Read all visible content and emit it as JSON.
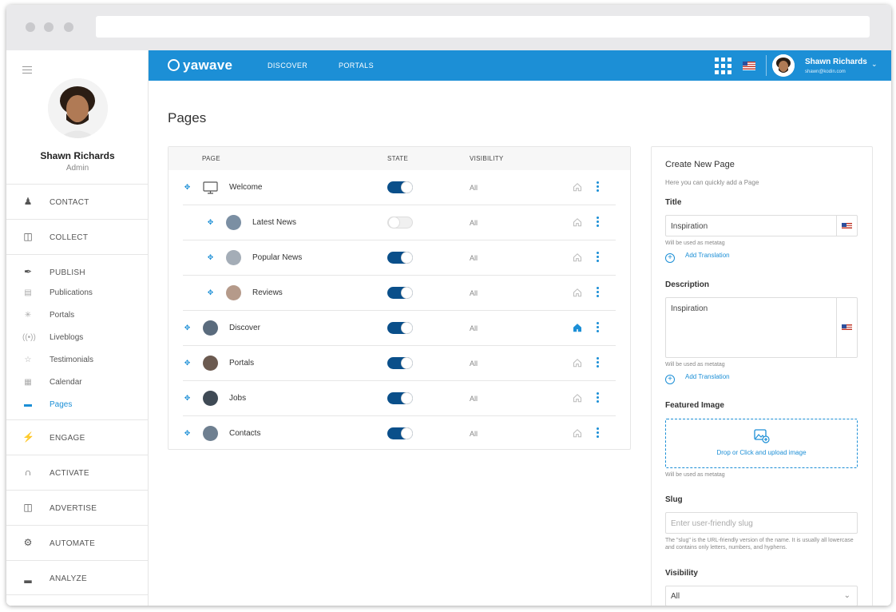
{
  "sidebar": {
    "user_name": "Shawn Richards",
    "user_role": "Admin",
    "sections": [
      {
        "label": "CONTACT",
        "icon": "contact-icon"
      },
      {
        "label": "COLLECT",
        "icon": "collect-icon"
      },
      {
        "label": "PUBLISH",
        "icon": "publish-icon"
      },
      {
        "label": "ENGAGE",
        "icon": "engage-icon"
      },
      {
        "label": "ACTIVATE",
        "icon": "activate-icon"
      },
      {
        "label": "ADVERTISE",
        "icon": "advertise-icon"
      },
      {
        "label": "AUTOMATE",
        "icon": "automate-icon"
      },
      {
        "label": "ANALYZE",
        "icon": "analyze-icon"
      }
    ],
    "publish_items": [
      {
        "label": "Publications",
        "icon": "publications-icon"
      },
      {
        "label": "Portals",
        "icon": "portals-icon"
      },
      {
        "label": "Liveblogs",
        "icon": "liveblogs-icon"
      },
      {
        "label": "Testimonials",
        "icon": "testimonials-icon"
      },
      {
        "label": "Calendar",
        "icon": "calendar-icon"
      },
      {
        "label": "Pages",
        "icon": "pages-icon"
      }
    ]
  },
  "topbar": {
    "logo_text": "yawave",
    "nav": [
      "DISCOVER",
      "PORTALS"
    ],
    "user_name": "Shawn Richards",
    "user_email": "shawn@kodin.com"
  },
  "main": {
    "title": "Pages",
    "columns": {
      "page": "PAGE",
      "state": "STATE",
      "visibility": "VISIBILITY"
    },
    "rows": [
      {
        "name": "Welcome",
        "state": true,
        "visibility": "All",
        "level": 0,
        "home": false
      },
      {
        "name": "Latest News",
        "state": false,
        "visibility": "All",
        "level": 1,
        "home": false
      },
      {
        "name": "Popular News",
        "state": true,
        "visibility": "All",
        "level": 1,
        "home": false
      },
      {
        "name": "Reviews",
        "state": true,
        "visibility": "All",
        "level": 1,
        "home": false
      },
      {
        "name": "Discover",
        "state": true,
        "visibility": "All",
        "level": 0,
        "home": true
      },
      {
        "name": "Portals",
        "state": true,
        "visibility": "All",
        "level": 0,
        "home": false
      },
      {
        "name": "Jobs",
        "state": true,
        "visibility": "All",
        "level": 0,
        "home": false
      },
      {
        "name": "Contacts",
        "state": true,
        "visibility": "All",
        "level": 0,
        "home": false
      }
    ]
  },
  "panel": {
    "heading": "Create New Page",
    "subtitle": "Here you can quickly add a Page",
    "title_label": "Title",
    "title_value": "Inspiration",
    "metatag_hint": "Will be used as metatag",
    "add_translation": "Add Translation",
    "description_label": "Description",
    "description_value": "Inspiration",
    "featured_label": "Featured Image",
    "dropzone_text": "Drop or Click and upload image",
    "slug_label": "Slug",
    "slug_placeholder": "Enter user-friendly slug",
    "slug_help": "The \"slug\" is the URL-friendly version of the name. It is usually all lowercase and contains only letters, numbers, and hyphens.",
    "visibility_label": "Visibility",
    "visibility_value": "All"
  },
  "colors": {
    "accent": "#1c8fd6",
    "toggle_on": "#0a4f8a"
  }
}
